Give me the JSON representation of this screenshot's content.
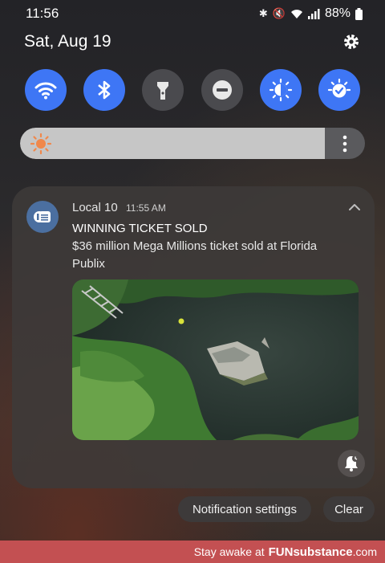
{
  "status_bar": {
    "time": "11:56",
    "battery": "88%",
    "icons": [
      "bluetooth-icon",
      "mute-icon",
      "wifi-icon",
      "signal-icon",
      "battery-icon"
    ]
  },
  "header": {
    "date": "Sat, Aug 19"
  },
  "quick_tiles": [
    {
      "name": "wifi",
      "state": "on"
    },
    {
      "name": "bluetooth",
      "state": "on"
    },
    {
      "name": "flashlight",
      "state": "off"
    },
    {
      "name": "do-not-disturb",
      "state": "off"
    },
    {
      "name": "eye-comfort",
      "state": "on"
    },
    {
      "name": "power-mode",
      "state": "on"
    }
  ],
  "brightness": {
    "level": 0.88
  },
  "notification": {
    "app": "Local 10",
    "time": "11:55 AM",
    "title": "WINNING TICKET SOLD",
    "body": "$36 million Mega Millions ticket sold at Florida Publix"
  },
  "actions": {
    "settings": "Notification settings",
    "clear": "Clear"
  },
  "footer": {
    "prefix": "Stay awake at",
    "brand": "FUNsubstance",
    "suffix": ".com"
  },
  "colors": {
    "accent": "#3e76f5",
    "footer": "#c35052",
    "card": "#3e3a39"
  }
}
